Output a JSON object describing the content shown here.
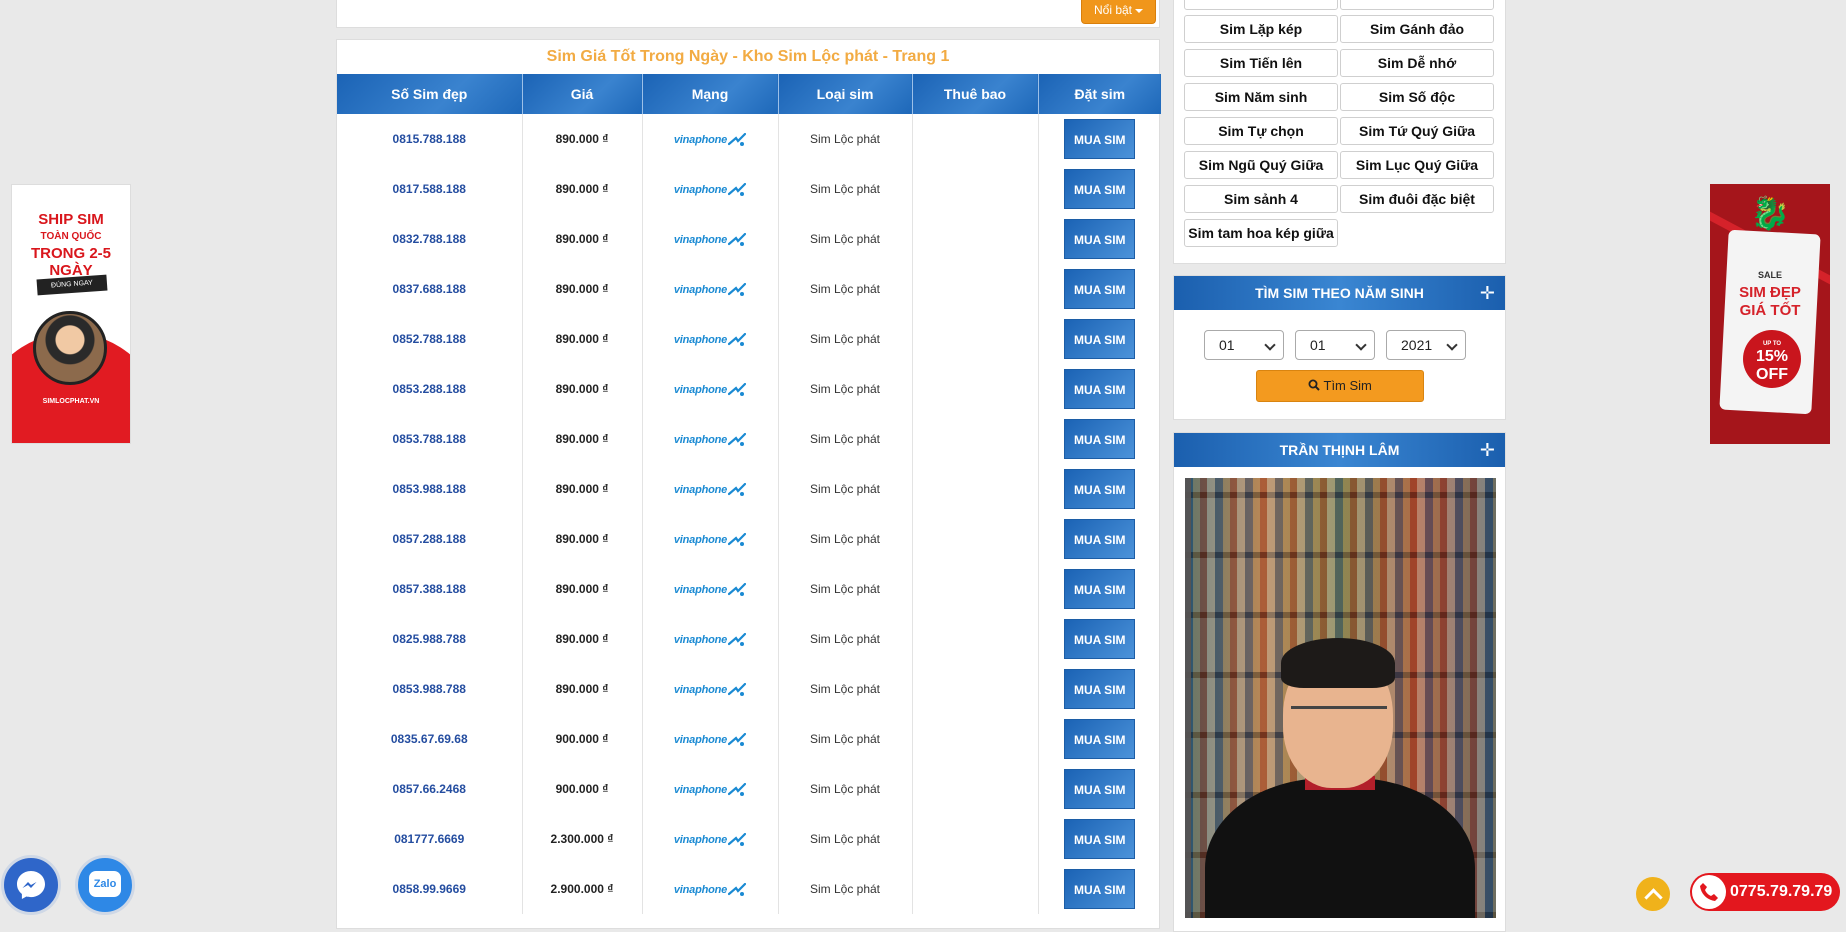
{
  "top_bar": {
    "noibat_label": "Nổi bật"
  },
  "panel": {
    "title": "Sim Giá Tốt Trong Ngày - Kho Sim Lộc phát - Trang 1",
    "columns": [
      "Số Sim đẹp",
      "Giá",
      "Mạng",
      "Loại sim",
      "Thuê bao",
      "Đặt sim"
    ],
    "network_label": "vinaphone",
    "buy_label": "MUA SIM",
    "rows": [
      {
        "number": "0815.788.188",
        "price": "890.000 ₫",
        "type": "Sim Lộc phát",
        "subscription": ""
      },
      {
        "number": "0817.588.188",
        "price": "890.000 ₫",
        "type": "Sim Lộc phát",
        "subscription": ""
      },
      {
        "number": "0832.788.188",
        "price": "890.000 ₫",
        "type": "Sim Lộc phát",
        "subscription": ""
      },
      {
        "number": "0837.688.188",
        "price": "890.000 ₫",
        "type": "Sim Lộc phát",
        "subscription": ""
      },
      {
        "number": "0852.788.188",
        "price": "890.000 ₫",
        "type": "Sim Lộc phát",
        "subscription": ""
      },
      {
        "number": "0853.288.188",
        "price": "890.000 ₫",
        "type": "Sim Lộc phát",
        "subscription": ""
      },
      {
        "number": "0853.788.188",
        "price": "890.000 ₫",
        "type": "Sim Lộc phát",
        "subscription": ""
      },
      {
        "number": "0853.988.188",
        "price": "890.000 ₫",
        "type": "Sim Lộc phát",
        "subscription": ""
      },
      {
        "number": "0857.288.188",
        "price": "890.000 ₫",
        "type": "Sim Lộc phát",
        "subscription": ""
      },
      {
        "number": "0857.388.188",
        "price": "890.000 ₫",
        "type": "Sim Lộc phát",
        "subscription": ""
      },
      {
        "number": "0825.988.788",
        "price": "890.000 ₫",
        "type": "Sim Lộc phát",
        "subscription": ""
      },
      {
        "number": "0853.988.788",
        "price": "890.000 ₫",
        "type": "Sim Lộc phát",
        "subscription": ""
      },
      {
        "number": "0835.67.69.68",
        "price": "900.000 ₫",
        "type": "Sim Lộc phát",
        "subscription": ""
      },
      {
        "number": "0857.66.2468",
        "price": "900.000 ₫",
        "type": "Sim Lộc phát",
        "subscription": ""
      },
      {
        "number": "081777.6669",
        "price": "2.300.000 ₫",
        "type": "Sim Lộc phát",
        "subscription": ""
      },
      {
        "number": "0858.99.9669",
        "price": "2.900.000 ₫",
        "type": "Sim Lộc phát",
        "subscription": ""
      }
    ]
  },
  "sidebar": {
    "categories": [
      "Sim Lặp kép",
      "Sim Gánh đảo",
      "Sim Tiến lên",
      "Sim Dễ nhớ",
      "Sim Năm sinh",
      "Sim Số độc",
      "Sim Tự chọn",
      "Sim Tứ Quý Giữa",
      "Sim Ngũ Quý Giữa",
      "Sim Lục Quý Giữa",
      "Sim sảnh 4",
      "Sim đuôi đặc biệt",
      "Sim tam hoa kép giữa"
    ],
    "birth_search": {
      "title": "TÌM SIM THEO NĂM SINH",
      "day": "01",
      "month": "01",
      "year": "2021",
      "button_label": "Tìm Sim"
    },
    "profile": {
      "title": "TRẦN THỊNH LÂM"
    }
  },
  "left_banner": {
    "line1": "SHIP SIM",
    "line2": "TOÀN QUỐC",
    "line3": "TRONG 2-5 NGÀY",
    "strip": "ĐÚNG NGAY",
    "site": "SIMLOCPHAT.VN"
  },
  "right_banner": {
    "sale": "SALE",
    "line1": "SIM ĐẸP",
    "line2": "GIÁ TỐT",
    "upto": "UP TO",
    "discount": "15% OFF"
  },
  "floating": {
    "zalo_label": "Zalo",
    "hotline": "0775.79.79.79"
  },
  "colors": {
    "accent_blue": "#1b63b5",
    "title_orange": "#f2ab43",
    "button_orange": "#f39a1f",
    "hotline_red": "#e3171e"
  }
}
